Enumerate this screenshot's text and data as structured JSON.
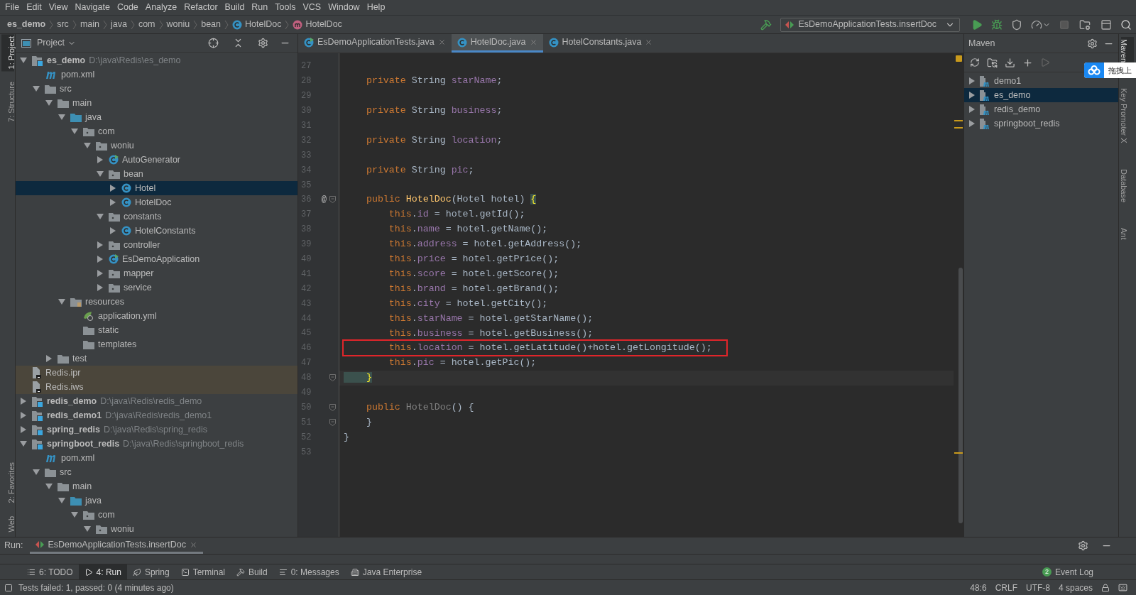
{
  "menu": [
    "File",
    "Edit",
    "View",
    "Navigate",
    "Code",
    "Analyze",
    "Refactor",
    "Build",
    "Run",
    "Tools",
    "VCS",
    "Window",
    "Help"
  ],
  "breadcrumbs": [
    {
      "label": "es_demo",
      "kind": "module"
    },
    {
      "label": "src",
      "kind": "plain"
    },
    {
      "label": "main",
      "kind": "plain"
    },
    {
      "label": "java",
      "kind": "plain"
    },
    {
      "label": "com",
      "kind": "plain"
    },
    {
      "label": "woniu",
      "kind": "plain"
    },
    {
      "label": "bean",
      "kind": "plain"
    },
    {
      "label": "HotelDoc",
      "kind": "class"
    },
    {
      "label": "HotelDoc",
      "kind": "method"
    }
  ],
  "run_config": "EsDemoApplicationTests.insertDoc",
  "left_stripe": {
    "top": [
      {
        "label": "1: Project",
        "selected": true
      },
      {
        "label": "7: Structure",
        "selected": false
      }
    ],
    "bottom": [
      {
        "label": "2: Favorites",
        "selected": false
      },
      {
        "label": "Web",
        "selected": false
      }
    ]
  },
  "project_panel": {
    "title": "Project",
    "tree": [
      {
        "label": "es_demo",
        "kind": "module",
        "path": "D:\\java\\Redis\\es_demo",
        "expanded": true,
        "selected": false,
        "children": [
          {
            "label": "pom.xml",
            "kind": "maven",
            "selected": false
          },
          {
            "label": "src",
            "kind": "folder",
            "expanded": true,
            "selected": false,
            "children": [
              {
                "label": "main",
                "kind": "folder",
                "expanded": true,
                "selected": false,
                "children": [
                  {
                    "label": "java",
                    "kind": "source",
                    "expanded": true,
                    "selected": false,
                    "children": [
                      {
                        "label": "com",
                        "kind": "package",
                        "expanded": true,
                        "selected": false,
                        "children": [
                          {
                            "label": "woniu",
                            "kind": "package",
                            "expanded": true,
                            "selected": false,
                            "children": [
                              {
                                "label": "AutoGenerator",
                                "kind": "runnable",
                                "expanded": false,
                                "selected": false
                              },
                              {
                                "label": "bean",
                                "kind": "package",
                                "expanded": true,
                                "selected": false,
                                "children": [
                                  {
                                    "label": "Hotel",
                                    "kind": "class",
                                    "expanded": false,
                                    "selected": true
                                  },
                                  {
                                    "label": "HotelDoc",
                                    "kind": "class",
                                    "expanded": false,
                                    "selected": false
                                  }
                                ]
                              },
                              {
                                "label": "constants",
                                "kind": "package",
                                "expanded": true,
                                "selected": false,
                                "children": [
                                  {
                                    "label": "HotelConstants",
                                    "kind": "class",
                                    "expanded": false,
                                    "selected": false
                                  }
                                ]
                              },
                              {
                                "label": "controller",
                                "kind": "package",
                                "expanded": false,
                                "selected": false
                              },
                              {
                                "label": "EsDemoApplication",
                                "kind": "runnable",
                                "expanded": false,
                                "selected": false
                              },
                              {
                                "label": "mapper",
                                "kind": "package",
                                "expanded": false,
                                "selected": false
                              },
                              {
                                "label": "service",
                                "kind": "package",
                                "expanded": false,
                                "selected": false
                              }
                            ]
                          }
                        ]
                      }
                    ]
                  },
                  {
                    "label": "resources",
                    "kind": "resources",
                    "expanded": true,
                    "selected": false,
                    "children": [
                      {
                        "label": "application.yml",
                        "kind": "yml",
                        "selected": false
                      },
                      {
                        "label": "static",
                        "kind": "folder",
                        "selected": false
                      },
                      {
                        "label": "templates",
                        "kind": "folder",
                        "selected": false
                      }
                    ]
                  }
                ]
              },
              {
                "label": "test",
                "kind": "folder",
                "expanded": false,
                "selected": false
              }
            ]
          }
        ]
      },
      {
        "label": "Redis.ipr",
        "kind": "project-file",
        "selected": false
      },
      {
        "label": "Redis.iws",
        "kind": "project-file",
        "selected": false
      },
      {
        "label": "redis_demo",
        "kind": "module",
        "path": "D:\\java\\Redis\\redis_demo",
        "expanded": false,
        "selected": false
      },
      {
        "label": "redis_demo1",
        "kind": "module",
        "path": "D:\\java\\Redis\\redis_demo1",
        "expanded": false,
        "selected": false
      },
      {
        "label": "spring_redis",
        "kind": "module",
        "path": "D:\\java\\Redis\\spring_redis",
        "expanded": false,
        "selected": false
      },
      {
        "label": "springboot_redis",
        "kind": "module",
        "path": "D:\\java\\Redis\\springboot_redis",
        "expanded": true,
        "selected": false,
        "children": [
          {
            "label": "pom.xml",
            "kind": "maven",
            "selected": false
          },
          {
            "label": "src",
            "kind": "folder",
            "expanded": true,
            "selected": false,
            "children": [
              {
                "label": "main",
                "kind": "folder",
                "expanded": true,
                "selected": false,
                "children": [
                  {
                    "label": "java",
                    "kind": "source",
                    "expanded": true,
                    "selected": false,
                    "children": [
                      {
                        "label": "com",
                        "kind": "package",
                        "expanded": true,
                        "selected": false,
                        "children": [
                          {
                            "label": "woniu",
                            "kind": "package",
                            "expanded": true,
                            "selected": false
                          }
                        ]
                      }
                    ]
                  }
                ]
              }
            ]
          }
        ]
      }
    ]
  },
  "editor_tabs": [
    {
      "label": "EsDemoApplicationTests.java",
      "kind": "runnable",
      "selected": false
    },
    {
      "label": "HotelDoc.java",
      "kind": "class",
      "selected": true
    },
    {
      "label": "HotelConstants.java",
      "kind": "class",
      "selected": false
    }
  ],
  "code": [
    {
      "number": "27"
    },
    {
      "number": "28",
      "tokens": [
        {
          "kind": "kw",
          "text": "    private"
        },
        {
          "kind": "plain",
          "text": " String "
        },
        {
          "kind": "field",
          "text": "starName"
        },
        {
          "kind": "plain",
          "text": ";"
        }
      ]
    },
    {
      "number": "29"
    },
    {
      "number": "30",
      "tokens": [
        {
          "kind": "kw",
          "text": "    private"
        },
        {
          "kind": "plain",
          "text": " String "
        },
        {
          "kind": "field",
          "text": "business"
        },
        {
          "kind": "plain",
          "text": ";"
        }
      ]
    },
    {
      "number": "31"
    },
    {
      "number": "32",
      "tokens": [
        {
          "kind": "kw",
          "text": "    private"
        },
        {
          "kind": "plain",
          "text": " String "
        },
        {
          "kind": "field",
          "text": "location"
        },
        {
          "kind": "plain",
          "text": ";"
        }
      ]
    },
    {
      "number": "33"
    },
    {
      "number": "34",
      "tokens": [
        {
          "kind": "kw",
          "text": "    private"
        },
        {
          "kind": "plain",
          "text": " String "
        },
        {
          "kind": "field",
          "text": "pic"
        },
        {
          "kind": "plain",
          "text": ";"
        }
      ]
    },
    {
      "number": "35"
    },
    {
      "number": "36",
      "annotation": "@",
      "fold": true,
      "tokens": [
        {
          "kind": "kw",
          "text": "    public "
        },
        {
          "kind": "method",
          "text": "HotelDoc"
        },
        {
          "kind": "plain",
          "text": "(Hotel hotel) "
        },
        {
          "kind": "brace",
          "text": "{"
        }
      ]
    },
    {
      "number": "37",
      "tokens": [
        {
          "kind": "kw",
          "text": "        this"
        },
        {
          "kind": "plain",
          "text": "."
        },
        {
          "kind": "field",
          "text": "id"
        },
        {
          "kind": "plain",
          "text": " = hotel.getId();"
        }
      ]
    },
    {
      "number": "38",
      "tokens": [
        {
          "kind": "kw",
          "text": "        this"
        },
        {
          "kind": "plain",
          "text": "."
        },
        {
          "kind": "field",
          "text": "name"
        },
        {
          "kind": "plain",
          "text": " = hotel.getName();"
        }
      ]
    },
    {
      "number": "39",
      "tokens": [
        {
          "kind": "kw",
          "text": "        this"
        },
        {
          "kind": "plain",
          "text": "."
        },
        {
          "kind": "field",
          "text": "address"
        },
        {
          "kind": "plain",
          "text": " = hotel.getAddress();"
        }
      ]
    },
    {
      "number": "40",
      "tokens": [
        {
          "kind": "kw",
          "text": "        this"
        },
        {
          "kind": "plain",
          "text": "."
        },
        {
          "kind": "field",
          "text": "price"
        },
        {
          "kind": "plain",
          "text": " = hotel.getPrice();"
        }
      ]
    },
    {
      "number": "41",
      "tokens": [
        {
          "kind": "kw",
          "text": "        this"
        },
        {
          "kind": "plain",
          "text": "."
        },
        {
          "kind": "field",
          "text": "score"
        },
        {
          "kind": "plain",
          "text": " = hotel.getScore();"
        }
      ]
    },
    {
      "number": "42",
      "tokens": [
        {
          "kind": "kw",
          "text": "        this"
        },
        {
          "kind": "plain",
          "text": "."
        },
        {
          "kind": "field",
          "text": "brand"
        },
        {
          "kind": "plain",
          "text": " = hotel.getBrand();"
        }
      ]
    },
    {
      "number": "43",
      "tokens": [
        {
          "kind": "kw",
          "text": "        this"
        },
        {
          "kind": "plain",
          "text": "."
        },
        {
          "kind": "field",
          "text": "city"
        },
        {
          "kind": "plain",
          "text": " = hotel.getCity();"
        }
      ]
    },
    {
      "number": "44",
      "tokens": [
        {
          "kind": "kw",
          "text": "        this"
        },
        {
          "kind": "plain",
          "text": "."
        },
        {
          "kind": "field",
          "text": "starName"
        },
        {
          "kind": "plain",
          "text": " = hotel.getStarName();"
        }
      ]
    },
    {
      "number": "45",
      "tokens": [
        {
          "kind": "kw",
          "text": "        this"
        },
        {
          "kind": "plain",
          "text": "."
        },
        {
          "kind": "field",
          "text": "business"
        },
        {
          "kind": "plain",
          "text": " = hotel.getBusiness();"
        }
      ]
    },
    {
      "number": "46",
      "boxed": true,
      "tokens": [
        {
          "kind": "kw",
          "text": "        this"
        },
        {
          "kind": "plain",
          "text": "."
        },
        {
          "kind": "field",
          "text": "location"
        },
        {
          "kind": "plain",
          "text": " = hotel.getLatitude()+hotel.getLongitude();"
        }
      ]
    },
    {
      "number": "47",
      "tokens": [
        {
          "kind": "kw",
          "text": "        this"
        },
        {
          "kind": "plain",
          "text": "."
        },
        {
          "kind": "field",
          "text": "pic"
        },
        {
          "kind": "plain",
          "text": " = hotel.getPic();"
        }
      ]
    },
    {
      "number": "48",
      "current": true,
      "fold": true,
      "tokens": [
        {
          "kind": "brace",
          "text": "    }"
        }
      ]
    },
    {
      "number": "49"
    },
    {
      "number": "50",
      "fold": true,
      "tokens": [
        {
          "kind": "kw",
          "text": "    public "
        },
        {
          "kind": "unused",
          "text": "HotelDoc"
        },
        {
          "kind": "plain",
          "text": "() {"
        }
      ]
    },
    {
      "number": "51",
      "fold": true,
      "tokens": [
        {
          "kind": "plain",
          "text": "    }"
        }
      ]
    },
    {
      "number": "52",
      "tokens": [
        {
          "kind": "plain",
          "text": "}"
        }
      ]
    },
    {
      "number": "53"
    }
  ],
  "maven": {
    "title": "Maven",
    "projects": [
      {
        "label": "demo1",
        "selected": false
      },
      {
        "label": "es_demo",
        "selected": true
      },
      {
        "label": "redis_demo",
        "selected": false
      },
      {
        "label": "springboot_redis",
        "selected": false
      }
    ]
  },
  "right_stripe": [
    {
      "label": "Maven",
      "selected": true
    },
    {
      "label": "Key Promoter X",
      "selected": false
    },
    {
      "label": "Database",
      "selected": false
    },
    {
      "label": "Ant",
      "selected": false
    }
  ],
  "floating_widget": {
    "label": "拖拽上"
  },
  "run_panel": {
    "label": "Run:",
    "tab": "EsDemoApplicationTests.insertDoc"
  },
  "tool_tabs": [
    {
      "label": "6: TODO",
      "kind": "list",
      "selected": false
    },
    {
      "label": "4: Run",
      "kind": "run",
      "selected": true
    },
    {
      "label": "Spring",
      "kind": "spring",
      "selected": false
    },
    {
      "label": "Terminal",
      "kind": "terminal",
      "selected": false
    },
    {
      "label": "Build",
      "kind": "build",
      "selected": false
    },
    {
      "label": "0: Messages",
      "kind": "messages",
      "selected": false
    },
    {
      "label": "Java Enterprise",
      "kind": "enterprise",
      "selected": false
    }
  ],
  "event_log": {
    "label": "Event Log",
    "count": "2"
  },
  "status_bar": {
    "message": "Tests failed: 1, passed: 0 (4 minutes ago)",
    "items": [
      "48:6",
      "CRLF",
      "UTF-8",
      "4 spaces"
    ]
  }
}
